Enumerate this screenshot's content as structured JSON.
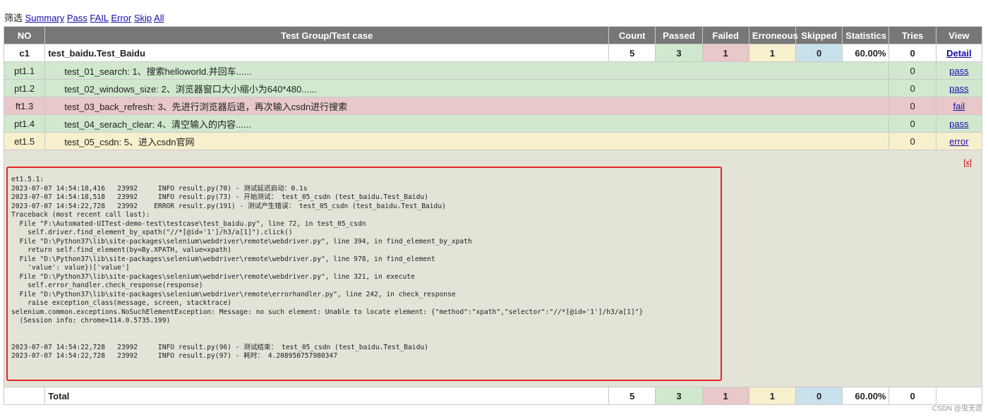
{
  "filter": {
    "label": "筛选",
    "links": [
      "Summary",
      "Pass",
      "FAIL",
      "Error",
      "Skip",
      "All"
    ]
  },
  "columns": [
    "NO",
    "Test Group/Test case",
    "Count",
    "Passed",
    "Failed",
    "Erroneous",
    "Skipped",
    "Statistics",
    "Tries",
    "View"
  ],
  "group": {
    "no": "c1",
    "name": "test_baidu.Test_Baidu",
    "count": "5",
    "passed": "3",
    "failed": "1",
    "erroneous": "1",
    "skipped": "0",
    "statistics": "60.00%",
    "tries": "0",
    "view": "Detail"
  },
  "cases": [
    {
      "no": "pt1.1",
      "name": "test_01_search: 1、搜索helloworld.并回车......",
      "tries": "0",
      "view": "pass",
      "status": "pass"
    },
    {
      "no": "pt1.2",
      "name": "test_02_windows_size: 2、浏览器窗口大小缩小为640*480......",
      "tries": "0",
      "view": "pass",
      "status": "pass"
    },
    {
      "no": "ft1.3",
      "name": "test_03_back_refresh: 3、先进行浏览器后退，再次输入csdn进行搜索",
      "tries": "0",
      "view": "fail",
      "status": "fail"
    },
    {
      "no": "pt1.4",
      "name": "test_04_serach_clear: 4、清空输入的内容......",
      "tries": "0",
      "view": "pass",
      "status": "pass"
    },
    {
      "no": "et1.5",
      "name": "test_05_csdn: 5、进入csdn官网",
      "tries": "0",
      "view": "error",
      "status": "error"
    }
  ],
  "log": {
    "close_label": "[x]",
    "text": "et1.5.1:\n2023-07-07 14:54:18,416   23992     INFO result.py(70) - 测试延迟启动：0.1s\n2023-07-07 14:54:18,518   23992     INFO result.py(73) - 开始测试： test_05_csdn (test_baidu.Test_Baidu)\n2023-07-07 14:54:22,728   23992    ERROR result.py(191) - 测试产生错误： test_05_csdn (test_baidu.Test_Baidu)\nTraceback (most recent call last):\n  File \"F:\\Automated-UITest-demo-test\\testcase\\test_baidu.py\", line 72, in test_05_csdn\n    self.driver.find_element_by_xpath(\"//*[@id='1']/h3/a[1]\").click()\n  File \"D:\\Python37\\lib\\site-packages\\selenium\\webdriver\\remote\\webdriver.py\", line 394, in find_element_by_xpath\n    return self.find_element(by=By.XPATH, value=xpath)\n  File \"D:\\Python37\\lib\\site-packages\\selenium\\webdriver\\remote\\webdriver.py\", line 978, in find_element\n    'value': value})['value']\n  File \"D:\\Python37\\lib\\site-packages\\selenium\\webdriver\\remote\\webdriver.py\", line 321, in execute\n    self.error_handler.check_response(response)\n  File \"D:\\Python37\\lib\\site-packages\\selenium\\webdriver\\remote\\errorhandler.py\", line 242, in check_response\n    raise exception_class(message, screen, stacktrace)\nselenium.common.exceptions.NoSuchElementException: Message: no such element: Unable to locate element: {\"method\":\"xpath\",\"selector\":\"//*[@id='1']/h3/a[1]\"}\n  (Session info: chrome=114.0.5735.199)\n\n\n2023-07-07 14:54:22,728   23992     INFO result.py(96) - 测试结束： test_05_csdn (test_baidu.Test_Baidu)\n2023-07-07 14:54:22,728   23992     INFO result.py(97) - 耗时： 4.208950757980347"
  },
  "total": {
    "label": "Total",
    "count": "5",
    "passed": "3",
    "failed": "1",
    "erroneous": "1",
    "skipped": "0",
    "statistics": "60.00%",
    "tries": "0"
  },
  "watermark": "CSDN @虫无涯",
  "colors": {
    "header_bg": "#777777",
    "pass_bg": "#d1e8cf",
    "fail_bg": "#e8c8c8",
    "error_bg": "#f7f0cd",
    "skip_bg": "#c9e1ec",
    "log_bg": "#e3e3d7",
    "highlight_border": "#e4262a"
  }
}
